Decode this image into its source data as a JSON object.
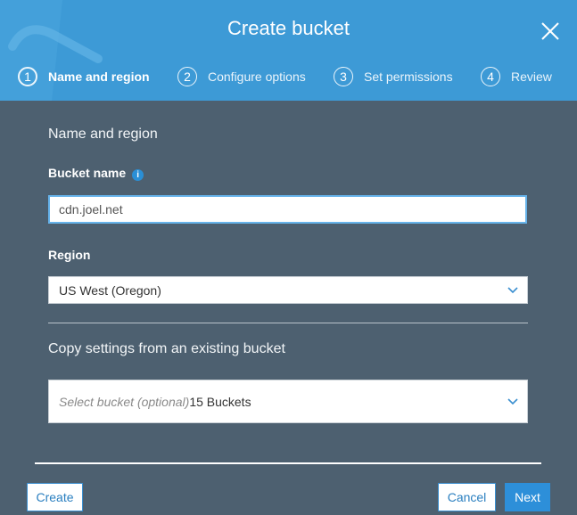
{
  "dialog": {
    "title": "Create bucket"
  },
  "steps": [
    {
      "number": "1",
      "label": "Name and region"
    },
    {
      "number": "2",
      "label": "Configure options"
    },
    {
      "number": "3",
      "label": "Set permissions"
    },
    {
      "number": "4",
      "label": "Review"
    }
  ],
  "form": {
    "section_title": "Name and region",
    "bucket_name_label": "Bucket name",
    "info_glyph": "i",
    "bucket_name_value": "cdn.joel.net",
    "region_label": "Region",
    "region_value": "US West (Oregon)",
    "copy_title": "Copy settings from an existing bucket",
    "copy_placeholder": "Select bucket (optional)",
    "copy_count": "15 Buckets"
  },
  "footer": {
    "create_label": "Create",
    "cancel_label": "Cancel",
    "next_label": "Next"
  },
  "icons": {
    "close": "close-icon",
    "info": "info-icon",
    "dropdown": "chevron-down-icon"
  },
  "colors": {
    "header": "#3d9ad6",
    "body": "#4d6070",
    "accent": "#2d8fd9"
  }
}
